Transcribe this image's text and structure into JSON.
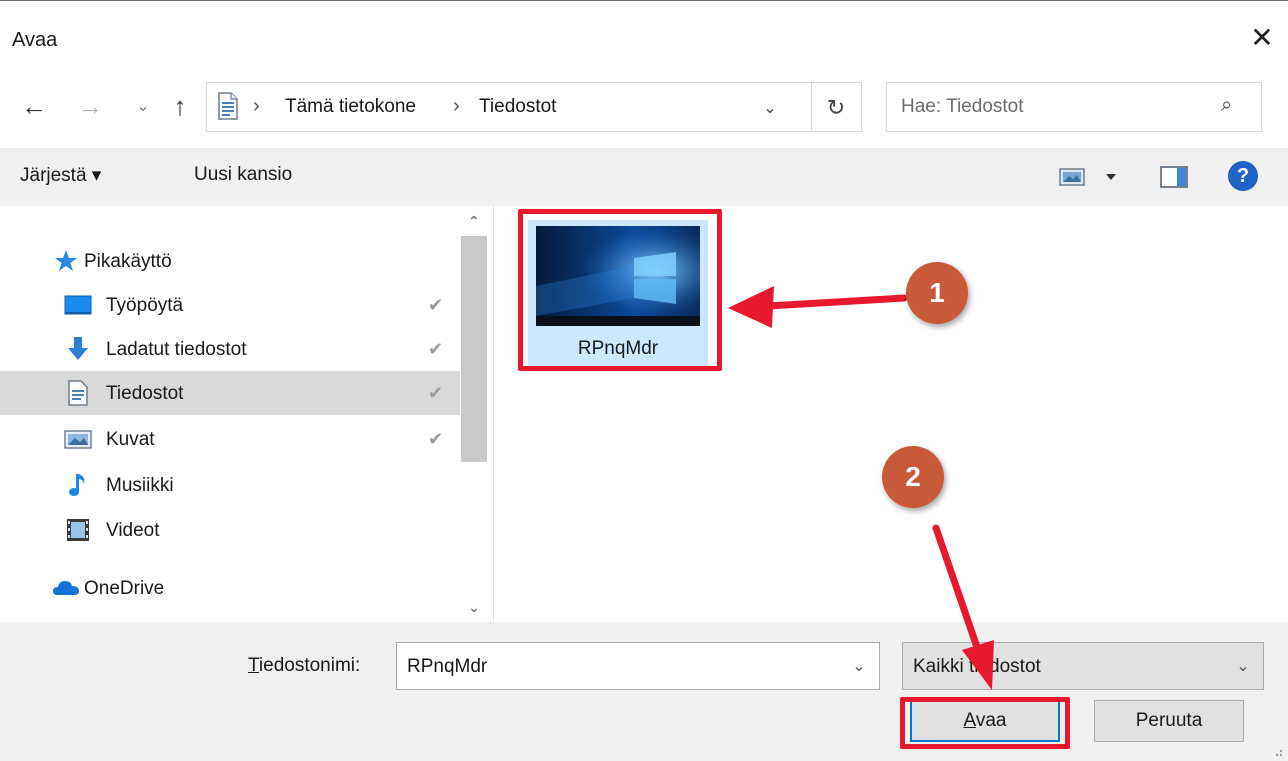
{
  "window": {
    "title": "Avaa",
    "close_symbol": "✕"
  },
  "nav": {
    "back": "←",
    "forward": "→",
    "recent": "⌄",
    "up": "↑"
  },
  "address": {
    "crumbs": [
      "Tämä tietokone",
      "Tiedostot"
    ],
    "separator": "›",
    "dropdown": "⌄",
    "refresh": "↻"
  },
  "search": {
    "placeholder": "Hae: Tiedostot",
    "icon": "⌕"
  },
  "toolbar": {
    "organize_label": "Järjestä ▾",
    "new_folder_label": "Uusi kansio",
    "view_icon": "view-icon",
    "preview_icon": "preview-pane-icon",
    "help_label": "?"
  },
  "sidebar": {
    "items": [
      {
        "label": "Pikakäyttö",
        "icon": "star-icon",
        "pinned": false
      },
      {
        "label": "Työpöytä",
        "icon": "desktop-icon",
        "pinned": true
      },
      {
        "label": "Ladatut tiedostot",
        "icon": "download-icon",
        "pinned": true
      },
      {
        "label": "Tiedostot",
        "icon": "documents-icon",
        "pinned": true,
        "selected": true
      },
      {
        "label": "Kuvat",
        "icon": "pictures-icon",
        "pinned": true
      },
      {
        "label": "Musiikki",
        "icon": "music-icon",
        "pinned": false
      },
      {
        "label": "Videot",
        "icon": "videos-icon",
        "pinned": false
      },
      {
        "label": "OneDrive",
        "icon": "cloud-icon",
        "pinned": false
      }
    ],
    "pin_symbol": "📌",
    "scroll_up": "⌃",
    "scroll_down": "⌄"
  },
  "content": {
    "files": [
      {
        "name": "RPnqMdr",
        "selected": true
      }
    ]
  },
  "footer": {
    "filename_label_prefix": "T",
    "filename_label_rest": "iedostonimi:",
    "filename_value": "RPnqMdr",
    "filetype_value": "Kaikki tiedostot",
    "open_label_prefix": "A",
    "open_label_rest": "vaa",
    "cancel_label": "Peruuta"
  },
  "annotations": {
    "markers": [
      "1",
      "2"
    ],
    "color": "#e8182e",
    "marker_color": "#c85a3a"
  },
  "colors": {
    "selection": "#cce8ff",
    "sidebar_selected": "#d9d9d9",
    "accent": "#0078d7",
    "help": "#1e63c6"
  }
}
